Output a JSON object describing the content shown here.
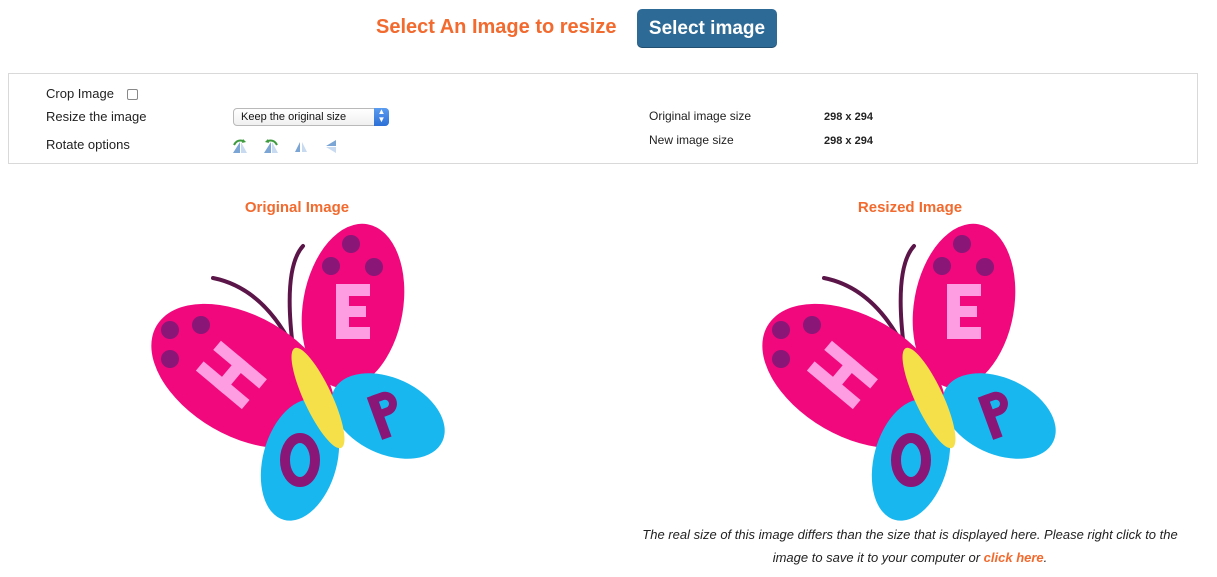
{
  "header": {
    "title": "Select An Image to resize",
    "select_button": "Select image"
  },
  "options": {
    "crop_label": "Crop Image",
    "crop_checked": false,
    "resize_label": "Resize the image",
    "resize_value": "Keep the original size",
    "rotate_label": "Rotate options",
    "rotate_icons": [
      "rotate-left-icon",
      "rotate-right-icon",
      "flip-vertical-icon",
      "flip-horizontal-icon"
    ]
  },
  "info": {
    "original_label": "Original image size",
    "original_value": "298 x 294",
    "new_label": "New image size",
    "new_value": "298 x 294"
  },
  "preview": {
    "original_heading": "Original Image",
    "resized_heading": "Resized Image",
    "note_text": "The real size of this image differs than the size that is displayed here. Please right click to the image to save it to your computer or ",
    "note_link": "click here",
    "note_end": "."
  },
  "colors": {
    "accent": "#f26a2e",
    "button": "#2e6a96",
    "wing_pink": "#f1087d",
    "wing_blue": "#18b7ef",
    "letter_pink": "#ff9de2",
    "letter_purple": "#8a1677",
    "dot_purple": "#8a1677",
    "body_yellow": "#f6e04a",
    "antenna": "#5b1548"
  }
}
